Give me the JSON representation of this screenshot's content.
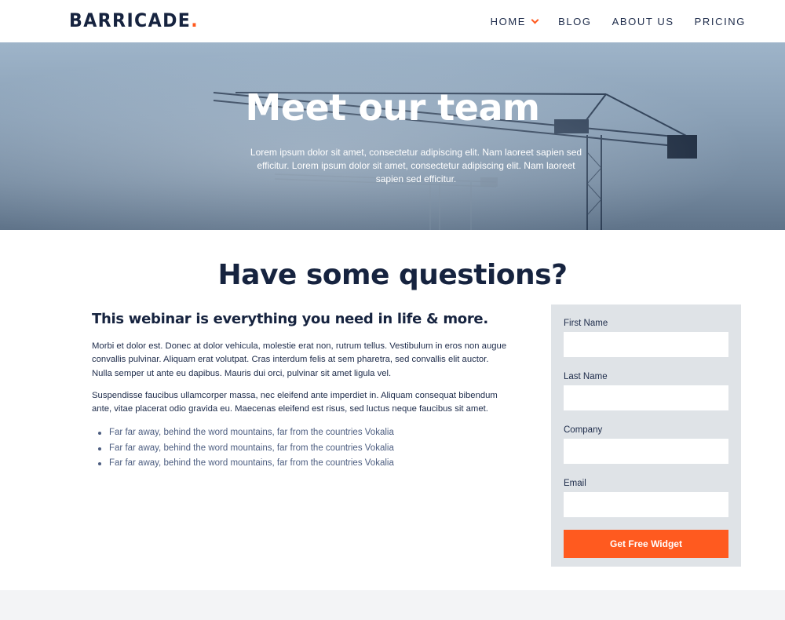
{
  "header": {
    "logo": "BARRICADE",
    "logo_dot": ".",
    "nav": [
      "HOME",
      "BLOG",
      "ABOUT US",
      "PRICING"
    ]
  },
  "hero": {
    "title": "Meet our team",
    "subtitle": "Lorem ipsum dolor sit amet, consectetur adipiscing elit. Nam laoreet sapien sed efficitur. Lorem ipsum dolor sit amet, consectetur adipiscing elit. Nam laoreet sapien sed efficitur."
  },
  "section": {
    "title": "Have some questions?",
    "subtitle": "This webinar is everything you need in life & more.",
    "paragraphs": [
      "Morbi et dolor est. Donec at dolor vehicula, molestie erat non, rutrum tellus. Vestibulum in eros non augue convallis pulvinar. Aliquam erat volutpat. Cras interdum felis at sem pharetra, sed convallis elit auctor. Nulla semper ut ante eu dapibus. Mauris dui orci, pulvinar sit amet ligula vel.",
      "Suspendisse faucibus ullamcorper massa, nec eleifend ante imperdiet in. Aliquam consequat bibendum ante, vitae placerat odio gravida eu. Maecenas eleifend est risus, sed luctus neque faucibus sit amet."
    ],
    "bullets": [
      "Far far away, behind the word mountains, far from the countries Vokalia",
      "Far far away, behind the word mountains, far from the countries Vokalia",
      "Far far away, behind the word mountains, far from the countries Vokalia"
    ]
  },
  "form": {
    "fields": [
      {
        "label": "First Name",
        "value": ""
      },
      {
        "label": "Last Name",
        "value": ""
      },
      {
        "label": "Company",
        "value": ""
      },
      {
        "label": "Email",
        "value": ""
      }
    ],
    "submit_label": "Get Free Widget"
  },
  "colors": {
    "accent": "#ff5a1f",
    "navy": "#16233f",
    "form_bg": "#dfe3e7"
  }
}
